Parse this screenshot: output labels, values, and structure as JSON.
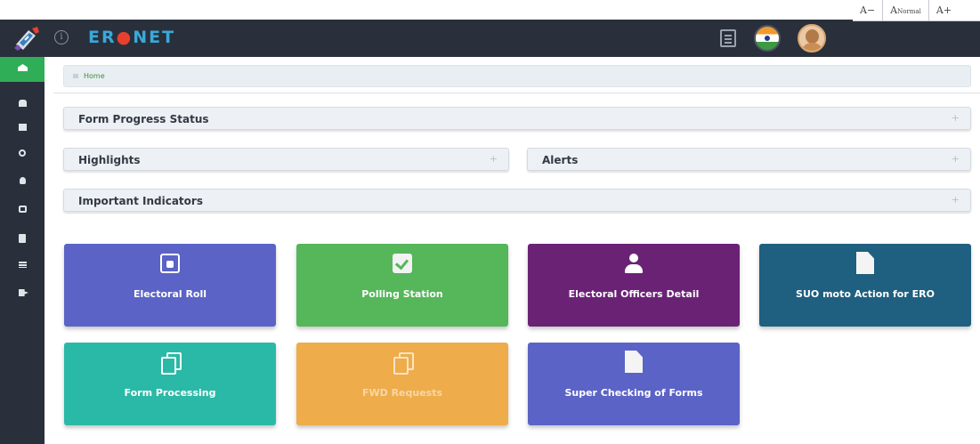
{
  "header": {
    "brand_prefix": "ER",
    "brand_suffix": "NET",
    "brand_colors": {
      "text": "#39a9d9",
      "dot": "#e8402f"
    },
    "font_controls": {
      "decrease": "A−",
      "normal_a": "A",
      "normal_word": "Normal",
      "increase": "A+"
    }
  },
  "sidebar": {
    "items": [
      {
        "icon": "home-icon",
        "active": true
      },
      {
        "icon": "users-icon"
      },
      {
        "icon": "inbox-icon"
      },
      {
        "icon": "search-icon"
      },
      {
        "icon": "user-icon"
      },
      {
        "icon": "copy-icon"
      },
      {
        "icon": "calculator-icon"
      },
      {
        "icon": "list-icon"
      },
      {
        "icon": "logout-icon"
      }
    ],
    "active_color": "#2fae57"
  },
  "breadcrumb": {
    "home": "Home"
  },
  "panels": {
    "form_progress": "Form Progress Status",
    "highlights": "Highlights",
    "alerts": "Alerts",
    "important": "Important Indicators",
    "expand_symbol": "+"
  },
  "tiles": {
    "electoral_roll": "Electoral Roll",
    "polling_station": "Polling Station",
    "electoral_officers": "Electoral Officers Detail",
    "suo_moto": "SUO moto Action for ERO",
    "form_processing": "Form Processing",
    "fwd_requests": "FWD Requests",
    "super_checking": "Super Checking of Forms"
  }
}
